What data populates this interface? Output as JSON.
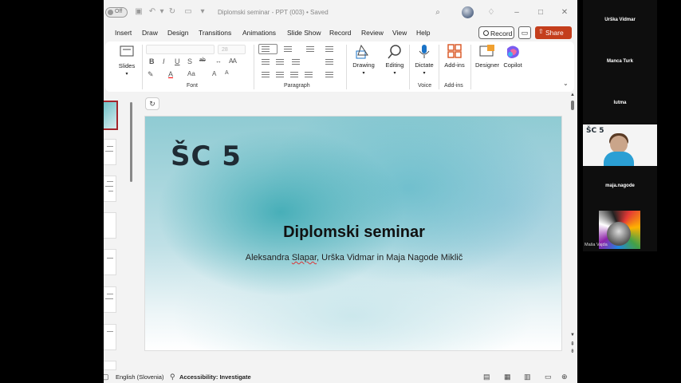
{
  "app": {
    "autosave_label": "Off",
    "doc_title": "Diplomski seminar - PPT (003) • Saved",
    "ribbon_tabs": [
      "Insert",
      "Draw",
      "Design",
      "Transitions",
      "Animations",
      "Slide Show",
      "Record",
      "Review",
      "View",
      "Help"
    ],
    "record_button": "Record",
    "share_button": "Share",
    "font_size": "28"
  },
  "ribbon": {
    "slides_label": "Slides",
    "font_group": "Font",
    "paragraph_group": "Paragraph",
    "drawing_label": "Drawing",
    "editing_label": "Editing",
    "dictate_label": "Dictate",
    "voice_group": "Voice",
    "addins_label": "Add-ins",
    "addins_group": "Add-ins",
    "designer_label": "Designer",
    "copilot_label": "Copilot",
    "font_buttons": [
      "B",
      "I",
      "U",
      "S",
      "ab"
    ]
  },
  "slide": {
    "logo": "ŠC 5",
    "title": "Diplomski seminar",
    "subtitle_pre": "Aleksandra ",
    "subtitle_flag": "Slapar",
    "subtitle_post": ", Urška Vidmar in Maja Nagode Miklič"
  },
  "status": {
    "language": "English (Slovenia)",
    "accessibility": "Accessibility: Investigate"
  },
  "participants": [
    {
      "name": "Urška Vidmar"
    },
    {
      "name": "Manca Turk"
    },
    {
      "name": "lutma"
    },
    {
      "name": "",
      "logo": "ŠC 5"
    },
    {
      "name": "maja.nagode"
    },
    {
      "name": "Maša Vajda"
    }
  ],
  "colors": {
    "accent": "#c43e1c",
    "active_thumb_border": "#a4262c",
    "status_bar": "#f3f3f3"
  }
}
